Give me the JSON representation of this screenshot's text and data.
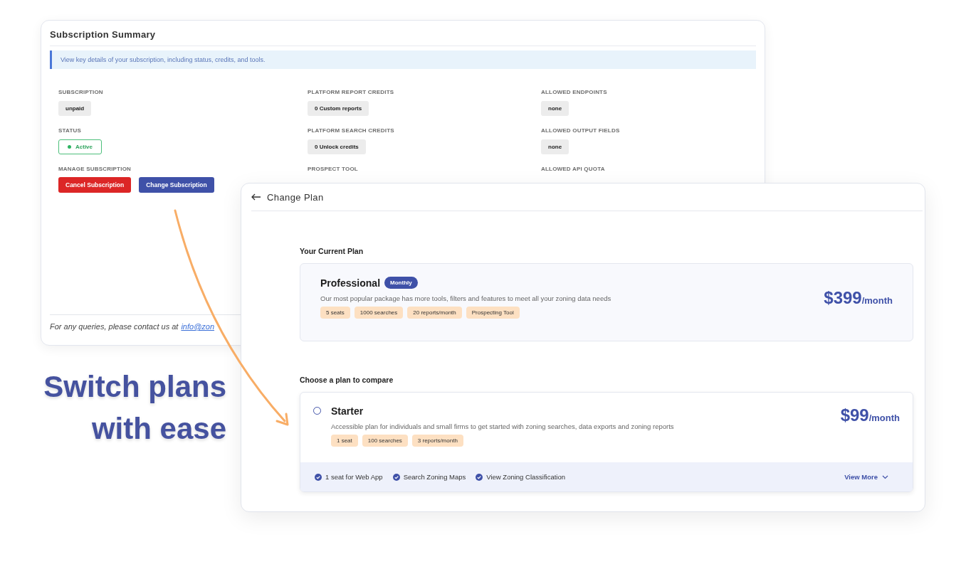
{
  "subscription_summary": {
    "title": "Subscription Summary",
    "info": "View key details of your subscription, including status, credits, and tools.",
    "fields": [
      {
        "label": "SUBSCRIPTION",
        "kind": "chip",
        "value": "unpaid"
      },
      {
        "label": "PLATFORM REPORT CREDITS",
        "kind": "chip",
        "value": "0 Custom reports"
      },
      {
        "label": "ALLOWED ENDPOINTS",
        "kind": "chip",
        "value": "none"
      },
      {
        "label": "STATUS",
        "kind": "status",
        "value": "Active",
        "active": true
      },
      {
        "label": "PLATFORM SEARCH CREDITS",
        "kind": "chip",
        "value": "0 Unlock credits"
      },
      {
        "label": "ALLOWED OUTPUT FIELDS",
        "kind": "chip",
        "value": "none"
      },
      {
        "label": "MANAGE SUBSCRIPTION",
        "kind": "buttons",
        "buttons": [
          {
            "label": "Cancel Subscription",
            "kind": "danger"
          },
          {
            "label": "Change Subscription",
            "kind": "primary"
          }
        ]
      },
      {
        "label": "PROSPECT TOOL",
        "kind": "label"
      },
      {
        "label": "ALLOWED API QUOTA",
        "kind": "label"
      }
    ],
    "footer": {
      "text": "For any queries, please contact us at",
      "link": "info@zon"
    }
  },
  "change_plan": {
    "title": "Change Plan",
    "current_heading": "Your Current Plan",
    "current_plan": {
      "name": "Professional",
      "billing": "Monthly",
      "description": "Our most popular package has more tools, filters and features to meet all your zoning data needs",
      "tags": [
        "5 seats",
        "1000 searches",
        "20 reports/month",
        "Prospecting Tool"
      ],
      "price": "$399",
      "period": "/month"
    },
    "compare_heading": "Choose a plan to compare",
    "plans": [
      {
        "name": "Starter",
        "selected": false,
        "description": "Accessible plan for individuals and small firms to get started with zoning searches, data exports and zoning reports",
        "tags": [
          "1 seat",
          "100 searches",
          "3 reports/month"
        ],
        "price": "$99",
        "period": "/month",
        "features": [
          "1 seat for Web App",
          "Search Zoning Maps",
          "View Zoning Classification"
        ],
        "view_more": "View More"
      }
    ]
  },
  "headline": [
    "Switch plans",
    "with ease"
  ]
}
